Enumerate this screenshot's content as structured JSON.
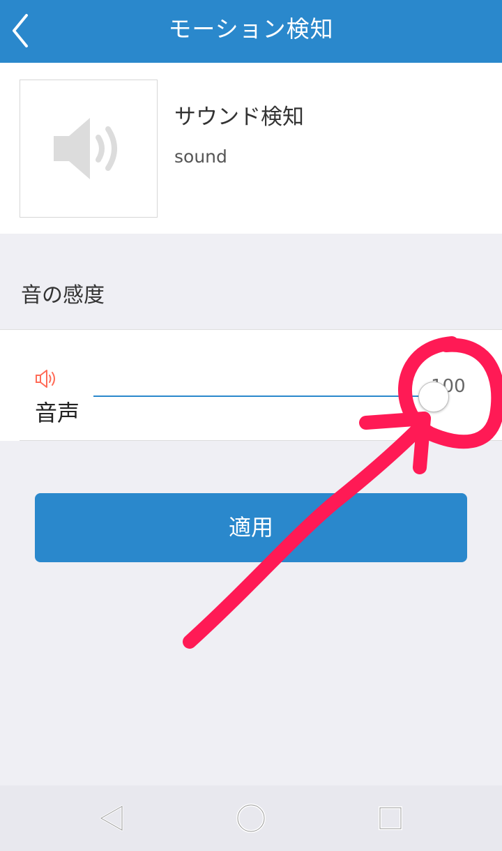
{
  "header": {
    "title": "モーション検知",
    "back_icon": "chevron-left-icon"
  },
  "device": {
    "name": "サウンド検知",
    "subtitle": "sound",
    "icon": "speaker-icon"
  },
  "sensitivity": {
    "section_title": "音の感度",
    "label": "音声",
    "icon": "speaker-icon",
    "value": "100",
    "level_percent": 100
  },
  "actions": {
    "apply_label": "適用"
  },
  "colors": {
    "primary": "#2a88cc",
    "annotation": "#ff1a55",
    "speaker_icon_accent": "#ff6b57"
  },
  "system_nav": {
    "back_icon": "triangle-back-icon",
    "home_icon": "circle-home-icon",
    "recents_icon": "square-recents-icon"
  }
}
